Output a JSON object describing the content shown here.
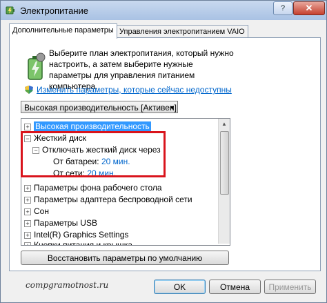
{
  "window": {
    "title": "Электропитание",
    "help_label": "?",
    "close_label": "✕"
  },
  "tabs": [
    {
      "label": "Дополнительные параметры"
    },
    {
      "label": "Управления электропитанием VAIO"
    }
  ],
  "intro": {
    "text": "Выберите план электропитания, который нужно настроить, а затем выберите нужные параметры для управления питанием компьютера.",
    "icon": "battery-shield-icon"
  },
  "change_link": "Изменить параметры, которые сейчас недоступны",
  "plan": {
    "selected": "Высокая производительность [Активен]"
  },
  "tree": [
    {
      "label": "Высокая производительность",
      "expander": "+",
      "selected": true
    },
    {
      "label": "Жесткий диск",
      "expander": "−"
    },
    {
      "label": "Отключать жесткий диск через",
      "expander": "−"
    },
    {
      "label": "От батареи:",
      "value": "20 мин."
    },
    {
      "label": "От сети:",
      "value": "20 мин."
    },
    {
      "label": "Параметры фона рабочего стола",
      "expander": "+"
    },
    {
      "label": "Параметры адаптера беспроводной сети",
      "expander": "+"
    },
    {
      "label": "Сон",
      "expander": "+"
    },
    {
      "label": "Параметры USB",
      "expander": "+"
    },
    {
      "label": "Intel(R) Graphics Settings",
      "expander": "+"
    },
    {
      "label": "Кнопки питания и крышка",
      "expander": "+"
    }
  ],
  "restore_label": "Восстановить параметры по умолчанию",
  "watermark": "compgramotnost.ru",
  "buttons": {
    "ok": "OK",
    "cancel": "Отмена",
    "apply": "Применить"
  },
  "colors": {
    "selection": "#3399ff",
    "highlight_border": "#d9141c",
    "link": "#0066cc"
  }
}
